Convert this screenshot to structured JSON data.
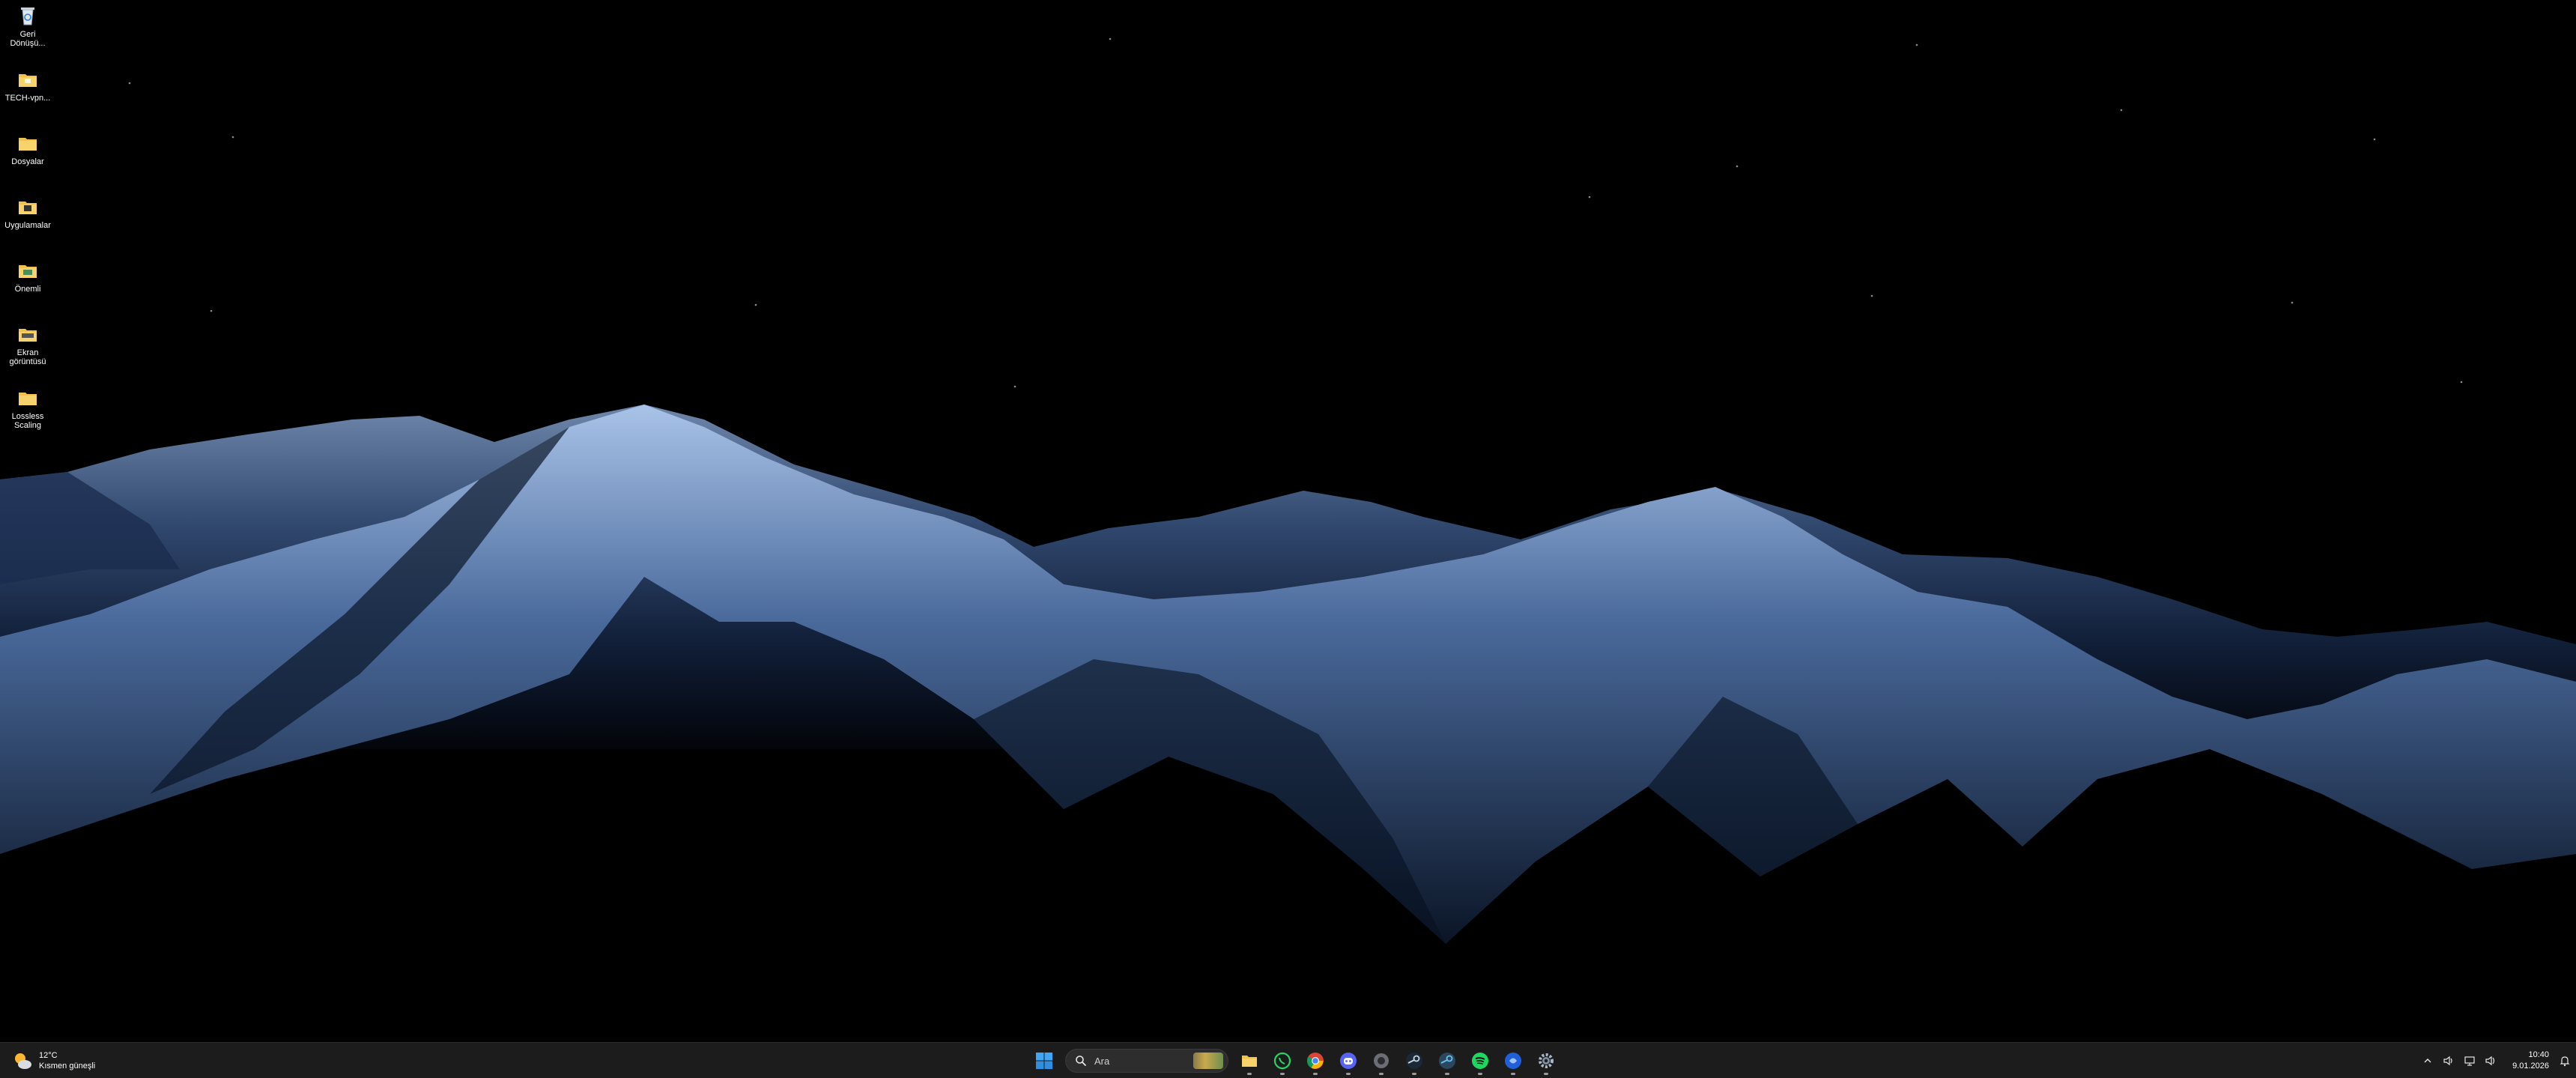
{
  "desktop": {
    "icons": [
      {
        "label": "Geri Dönüşü...",
        "icon": "recycle-bin-icon"
      },
      {
        "label": "TECH-vpn...",
        "icon": "folder-icon"
      },
      {
        "label": "Dosyalar",
        "icon": "folder-icon"
      },
      {
        "label": "Uygulamalar",
        "icon": "folder-icon"
      },
      {
        "label": "Önemli",
        "icon": "folder-icon"
      },
      {
        "label": "Ekran görüntüsü",
        "icon": "folder-icon"
      },
      {
        "label": "Lossless Scaling",
        "icon": "folder-icon"
      }
    ]
  },
  "taskbar": {
    "weather": {
      "temp": "12°C",
      "condition": "Kısmen güneşli",
      "icon": "partly-sunny-icon"
    },
    "search": {
      "placeholder": "Ara"
    },
    "pinned": [
      {
        "name": "start",
        "icon": "windows-start-icon",
        "running": false
      },
      {
        "name": "file-explorer",
        "icon": "folder-icon",
        "running": true
      },
      {
        "name": "whatsapp",
        "icon": "whatsapp-icon",
        "running": true
      },
      {
        "name": "chrome",
        "icon": "chrome-icon",
        "running": true
      },
      {
        "name": "discord",
        "icon": "discord-icon",
        "running": true
      },
      {
        "name": "app-dark",
        "icon": "dark-app-icon",
        "running": true
      },
      {
        "name": "steam",
        "icon": "steam-icon",
        "running": true
      },
      {
        "name": "steam-alt",
        "icon": "steam-icon",
        "running": true
      },
      {
        "name": "spotify",
        "icon": "spotify-icon",
        "running": true
      },
      {
        "name": "app-blue",
        "icon": "blue-app-icon",
        "running": true
      },
      {
        "name": "settings",
        "icon": "gear-icon",
        "running": true
      }
    ],
    "tray": {
      "time": "10:40",
      "date": "9.01.2026",
      "icons": [
        "chevron-up-icon",
        "volume-icon",
        "network-icon",
        "speaker-icon"
      ]
    }
  },
  "colors": {
    "taskbar_bg": "#1c1c1c",
    "accent": "#0078d4",
    "folder_yellow": "#f3c24a"
  }
}
